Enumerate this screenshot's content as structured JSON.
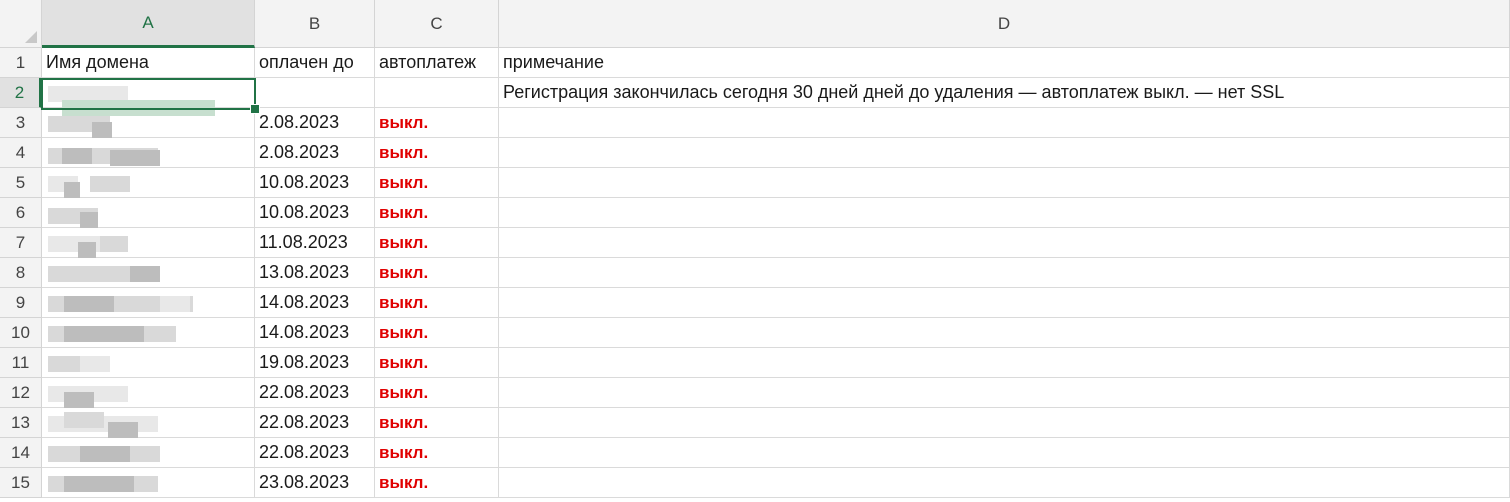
{
  "columns": [
    "A",
    "B",
    "C",
    "D"
  ],
  "selected_cell": "A2",
  "rows": [
    {
      "num": "1",
      "a": "Имя домена",
      "b": "оплачен до",
      "c": "автоплатеж",
      "d": "примечание"
    },
    {
      "num": "2",
      "a": "",
      "b": "",
      "c": "",
      "d": "Регистрация закончилась сегодня  30 дней дней до удаления — автоплатеж выкл. — нет SSL"
    },
    {
      "num": "3",
      "a": "",
      "b": "2.08.2023",
      "c": "выкл.",
      "d": ""
    },
    {
      "num": "4",
      "a": "",
      "b": "2.08.2023",
      "c": "выкл.",
      "d": ""
    },
    {
      "num": "5",
      "a": "",
      "b": "10.08.2023",
      "c": "выкл.",
      "d": ""
    },
    {
      "num": "6",
      "a": "",
      "b": "10.08.2023",
      "c": "выкл.",
      "d": ""
    },
    {
      "num": "7",
      "a": "",
      "b": "11.08.2023",
      "c": "выкл.",
      "d": ""
    },
    {
      "num": "8",
      "a": "",
      "b": "13.08.2023",
      "c": "выкл.",
      "d": ""
    },
    {
      "num": "9",
      "a": "",
      "b": "14.08.2023",
      "c": "выкл.",
      "d": ""
    },
    {
      "num": "10",
      "a": "",
      "b": "14.08.2023",
      "c": "выкл.",
      "d": ""
    },
    {
      "num": "11",
      "a": "",
      "b": "19.08.2023",
      "c": "выкл.",
      "d": ""
    },
    {
      "num": "12",
      "a": "",
      "b": "22.08.2023",
      "c": "выкл.",
      "d": ""
    },
    {
      "num": "13",
      "a": "",
      "b": "22.08.2023",
      "c": "выкл.",
      "d": ""
    },
    {
      "num": "14",
      "a": "",
      "b": "22.08.2023",
      "c": "выкл.",
      "d": ""
    },
    {
      "num": "15",
      "a": "",
      "b": "23.08.2023",
      "c": "выкл.",
      "d": ""
    }
  ],
  "colors": {
    "accent": "#217346",
    "off_status": "#e00000"
  }
}
